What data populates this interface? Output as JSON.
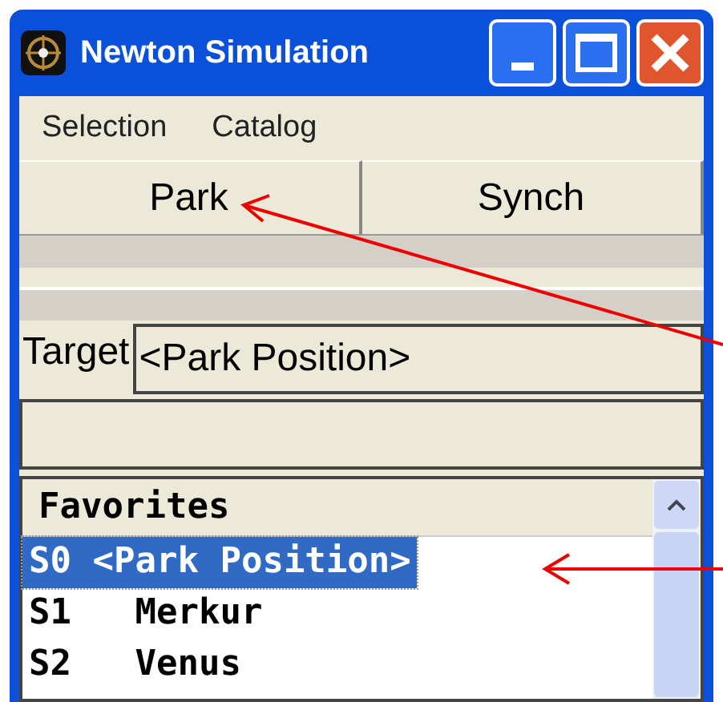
{
  "window": {
    "title": "Newton Simulation"
  },
  "menu": [
    "Selection",
    "Catalog"
  ],
  "buttons": [
    "Park",
    "Synch"
  ],
  "target": {
    "label": "Target",
    "value": "<Park Position>"
  },
  "list": {
    "header": "Favorites",
    "items": [
      {
        "text": "S0 <Park Position>",
        "selected": true
      },
      {
        "text": "S1   Merkur",
        "selected": false
      },
      {
        "text": "S2   Venus",
        "selected": false
      }
    ]
  }
}
